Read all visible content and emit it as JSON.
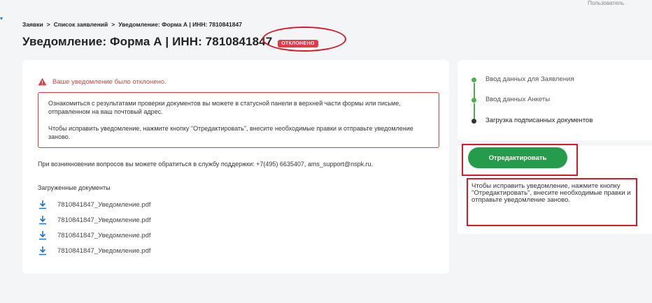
{
  "header": {
    "user_label": "Пользователь",
    "breadcrumb": [
      "Заявки",
      "Список заявлений",
      "Уведомление: Форма А | ИНН: 7810841847"
    ],
    "breadcrumb_sep": ">",
    "title": "Уведомление: Форма А | ИНН: 7810841847",
    "status": "ОТКЛОНЕНО"
  },
  "main": {
    "alert_title": "Ваше уведомление было отклонено.",
    "alert_p1": "Ознакомиться с результатами проверки документов вы можете в статусной панели в верхней части формы или письме, отправленном на ваш почтовый адрес.",
    "alert_p2": "Чтобы исправить уведомление, нажмите кнопку \"Отредактировать\", внесите необходимые правки и отправьте уведомление заново.",
    "support": "При возникновении вопросов вы можете обратиться в службу поддержки: +7(495) 6635407, ams_support@nspk.ru.",
    "docs_label": "Загруженные документы",
    "documents": [
      "7810841847_Уведомление.pdf",
      "7810841847_Уведомление.pdf",
      "7810841847_Уведомление.pdf",
      "7810841847_Уведомление.pdf"
    ]
  },
  "sidebar": {
    "steps": [
      {
        "label": "Ввод данных для Заявления",
        "state": "done"
      },
      {
        "label": "Ввод данных Анкеты",
        "state": "done"
      },
      {
        "label": "Загрузка подписанных документов",
        "state": "current"
      }
    ],
    "edit_button": "Отредактировать",
    "hint": "Чтобы исправить уведомление, нажмите кнопку \"Отредактировать\", внесите необходимые правки и отправьте уведомление заново."
  },
  "colors": {
    "accent_green": "#259c4c",
    "danger_red": "#e53945",
    "annotation_red": "#d7192a",
    "link_blue": "#1a73c8"
  }
}
